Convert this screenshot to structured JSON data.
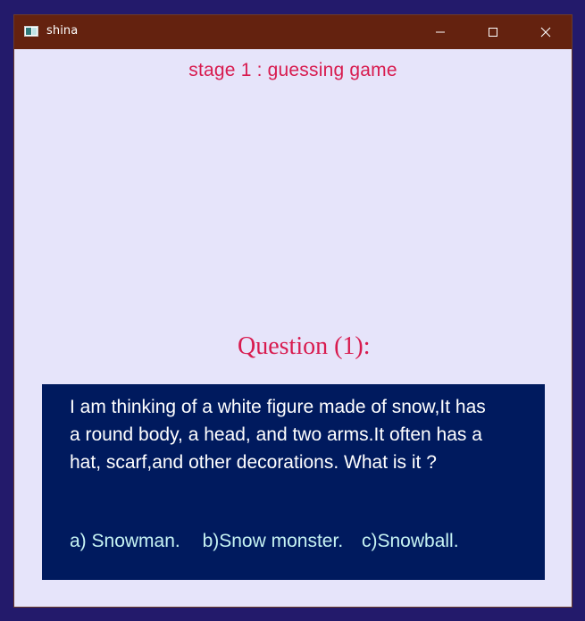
{
  "window": {
    "title": "shina",
    "icon": "app-window-icon",
    "controls": [
      "minimize-icon",
      "maximize-icon",
      "close-icon"
    ]
  },
  "stage_title": "stage 1 : guessing game",
  "question": {
    "heading": "Question (1):",
    "text": "I am thinking of a white figure made of snow,It has\na round body, a head, and two arms.It often has a\nhat, scarf,and other decorations. What is it ?",
    "answers": [
      "a) Snowman.",
      "b)Snow monster.",
      "c)Snowball."
    ]
  },
  "colors": {
    "background": "#231a6b",
    "titlebar": "#64220f",
    "client_area": "#e6e4fa",
    "accent_text": "#d81b4f",
    "panel": "#001a5e",
    "answer_text": "#c6f3f3"
  }
}
